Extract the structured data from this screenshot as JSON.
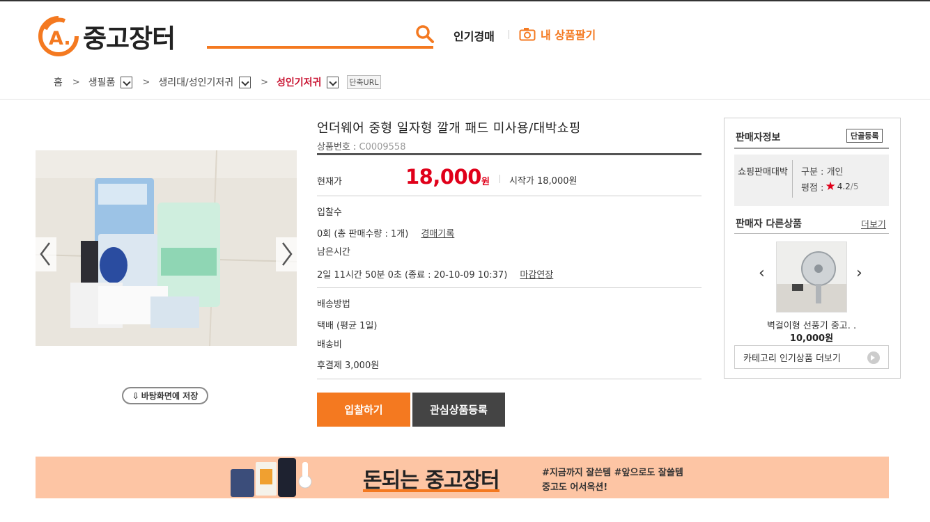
{
  "header": {
    "logo_letter": "A.",
    "logo_text": "중고장터",
    "nav_popular": "인기경매",
    "nav_sell": "내 상품팔기"
  },
  "breadcrumb": {
    "home": "홈",
    "level1": "생필품",
    "level2": "생리대/성인기저귀",
    "level3": "성인기저귀",
    "short_url": "단축URL"
  },
  "product": {
    "title": "언더웨어 중형 일자형 깔개 패드 미사용/대박쇼핑",
    "number_label": "상품번호 : ",
    "number_value": "C0009558",
    "current_price_label": "현재가",
    "current_price": "18,000",
    "currency": "원",
    "start_price": "시작가 18,000원",
    "bids_label": "입찰수",
    "bids_value": "0회 (총 판매수량 : 1개)",
    "bid_history_link": "경매기록",
    "remaining_label": "남은시간",
    "remaining_value": "2일 11시간 50분 0초 (종료 : 20-10-09 10:37)",
    "extend_link": "마감연장",
    "shipping_label": "배송방법",
    "shipping_value": "택배 (평균 1일)",
    "shipping_fee_label": "배송비",
    "shipping_fee_value": "후결제 3,000원",
    "save_wallpaper": "바탕화면에 저장",
    "bid_button": "입찰하기",
    "wish_button": "관심상품등록"
  },
  "seller": {
    "title": "판매자정보",
    "register_button": "단골등록",
    "name": "쇼핑판매대박",
    "kind": "구분 : 개인",
    "rating_label": "평점 :",
    "rating_value": "4.2",
    "rating_max": "/5",
    "other_title": "판매자 다른상품",
    "more_link": "더보기",
    "other_item_name": "벽걸이형 선풍기 중고. .",
    "other_item_price": "10,000원",
    "category_more": "카테고리 인기상품 더보기"
  },
  "banner": {
    "title": "돈되는 중고장터",
    "sub1": "#지금까지 잘쓴템 #앞으로도 잘쓸템",
    "sub2": "중고도 어서옥션!"
  },
  "colors": {
    "brand_orange": "#f47920",
    "price_red": "#e0001a",
    "banner_bg": "#fdc5a4",
    "dark_button": "#444444"
  },
  "icons": {
    "search": "search-icon",
    "camera": "camera-icon",
    "star": "star-icon",
    "prev": "chevron-left-icon",
    "next": "chevron-right-icon"
  }
}
